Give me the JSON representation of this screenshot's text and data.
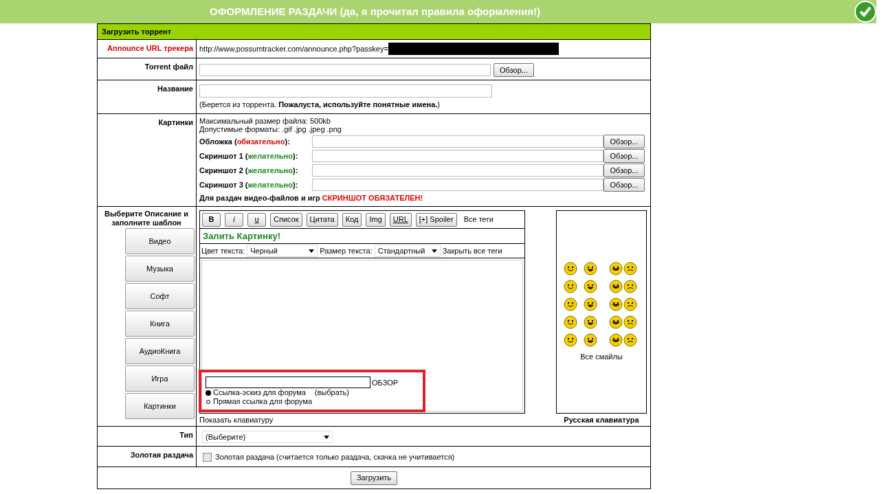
{
  "banner": {
    "title": "ОФОРМЛЕНИЕ РАЗДАЧИ (да, я прочитал правила оформления!)"
  },
  "form": {
    "heading": "Загрузить торрент",
    "announce": {
      "label": "Announce URL трекера",
      "value": "http://www.possumtracker.com/announce.php?passkey="
    },
    "torrent_file": {
      "label": "Torrent файл",
      "button": "Обзор..."
    },
    "name": {
      "label": "Название",
      "hint": "(Берется из торрента. **Пожалуста, используйте понятные имена.**)"
    },
    "pictures": {
      "label": "Картинки",
      "info": [
        "Максимальный размер файла: 500kb",
        "Допустимые форматы: .gif .jpg .jpeg .png"
      ],
      "fields": [
        {
          "before": "Обложка (",
          "note": "обязательно",
          "after": "):",
          "required": true,
          "button": "Обзор..."
        },
        {
          "before": "Скриншот 1 (",
          "note": "желательно",
          "after": "):",
          "required": false,
          "button": "Обзор..."
        },
        {
          "before": "Скриншот 2 (",
          "note": "желательно",
          "after": "):",
          "required": false,
          "button": "Обзор..."
        },
        {
          "before": "Скриншот 3 (",
          "note": "желательно",
          "after": "):",
          "required": false,
          "button": "Обзор..."
        }
      ],
      "warning": "Для раздач видео-файлов и игр",
      "warning_emphasis": "СКРИНШОТ ОБЯЗАТЕЛЕН!"
    },
    "description": {
      "label": "Выберите Описание и заполните шаблон",
      "templates": [
        "Видео",
        "Музыка",
        "Софт",
        "Книга",
        "АудиоКнига",
        "Игра",
        "Картинки"
      ],
      "toolbar": [
        {
          "label": "B",
          "kind": "bold"
        },
        {
          "label": "i",
          "kind": "italic"
        },
        {
          "label": "u",
          "kind": "underline"
        },
        {
          "label": "Список",
          "kind": "plain"
        },
        {
          "label": "Цитата",
          "kind": "plain"
        },
        {
          "label": "Код",
          "kind": "plain"
        },
        {
          "label": "Img",
          "kind": "plain"
        },
        {
          "label": "URL",
          "kind": "underline"
        },
        {
          "label": "[+] Spoiler",
          "kind": "plain"
        }
      ],
      "all_tags": "Все теги",
      "upload_link": "Залить Картинку!",
      "color_label": "Цвет текста:",
      "color_value": "Черный",
      "size_label": "Размер текста:",
      "size_value": "Стандартный",
      "close_tags": "Закрыть все теги",
      "upload": {
        "button": "ОБЗОР",
        "options": [
          {
            "label": "Ссылка-эскиз для форума",
            "extra": "(выбрать)",
            "selected": true
          },
          {
            "label": "Прямая ссылка для форума",
            "selected": false
          }
        ]
      },
      "keyboard_link": "Показать клавиатуру",
      "all_smilies": "Все смайлы",
      "keyboard": "Русская клавиатура"
    },
    "type": {
      "label": "Тип",
      "value": "(Выберите)"
    },
    "gold": {
      "label": "Золотая раздача",
      "text": "Золотая раздача (считается только раздача, скачка не учитивается)",
      "checked": false
    },
    "submit": "Загрузить"
  }
}
